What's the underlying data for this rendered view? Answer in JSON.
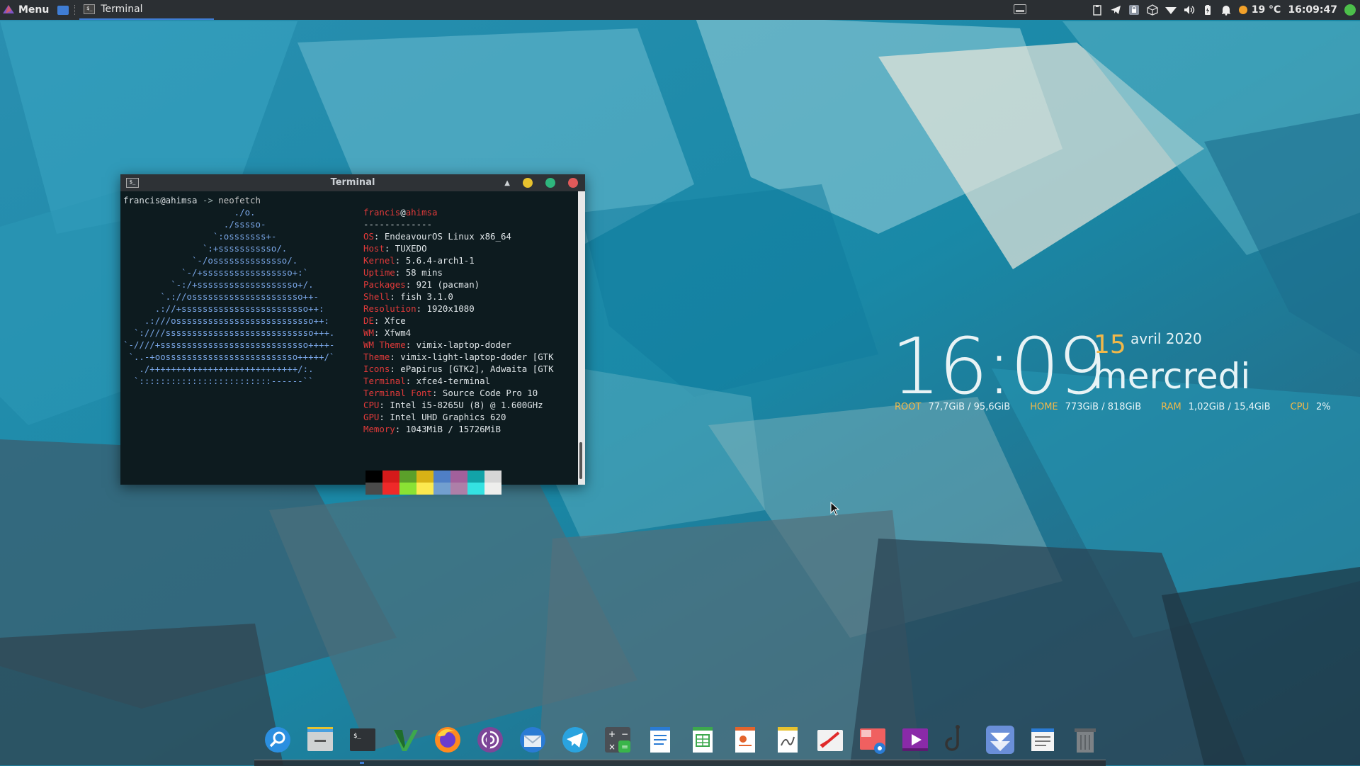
{
  "top_panel": {
    "menu_label": "Menu",
    "task_title": "Terminal",
    "temperature": "19 °C",
    "clock": "16:09:47"
  },
  "conky": {
    "time": "16:09",
    "day_number": "15",
    "month_year": "avril 2020",
    "weekday": "mercredi",
    "stats": [
      {
        "label": "ROOT",
        "value": "77,7GiB / 95,6GiB"
      },
      {
        "label": "HOME",
        "value": "773GiB / 818GiB"
      },
      {
        "label": "RAM",
        "value": "1,02GiB / 15,4GiB"
      },
      {
        "label": "CPU",
        "value": "2%"
      }
    ]
  },
  "terminal": {
    "title": "Terminal",
    "prompt_user": "francis@ahimsa",
    "prompt_arrow": " -> ",
    "command": "neofetch",
    "ascii_art": [
      "                     ./o.",
      "                   ./sssso-",
      "                 `:osssssss+-",
      "               `:+sssssssssso/.",
      "             `-/ossssssssssssso/.",
      "           `-/+sssssssssssssssso+:`",
      "         `-:/+sssssssssssssssssso+/.",
      "       `.://osssssssssssssssssssso++-",
      "      .://+ssssssssssssssssssssssso++:",
      "    .:///ossssssssssssssssssssssssso++:",
      "  `:////ssssssssssssssssssssssssssso+++.",
      "`-////+ssssssssssssssssssssssssssso++++-",
      " `..-+oosssssssssssssssssssssssso+++++/`",
      "   ./++++++++++++++++++++++++++++/:.",
      "  `:::::::::::::::::::::::::------``"
    ],
    "info_user": "francis",
    "info_at": "@",
    "info_host": "ahimsa",
    "info_sep": "-------------",
    "info": [
      {
        "key": "OS",
        "value": "EndeavourOS Linux x86_64"
      },
      {
        "key": "Host",
        "value": "TUXEDO"
      },
      {
        "key": "Kernel",
        "value": "5.6.4-arch1-1"
      },
      {
        "key": "Uptime",
        "value": "58 mins"
      },
      {
        "key": "Packages",
        "value": "921 (pacman)"
      },
      {
        "key": "Shell",
        "value": "fish 3.1.0"
      },
      {
        "key": "Resolution",
        "value": "1920x1080"
      },
      {
        "key": "DE",
        "value": "Xfce"
      },
      {
        "key": "WM",
        "value": "Xfwm4"
      },
      {
        "key": "WM Theme",
        "value": "vimix-laptop-doder"
      },
      {
        "key": "Theme",
        "value": "vimix-light-laptop-doder [GTK"
      },
      {
        "key": "Icons",
        "value": "ePapirus [GTK2], Adwaita [GTK"
      },
      {
        "key": "Terminal",
        "value": "xfce4-terminal"
      },
      {
        "key": "Terminal Font",
        "value": "Source Code Pro 10"
      },
      {
        "key": "CPU",
        "value": "Intel i5-8265U (8) @ 1.600GHz"
      },
      {
        "key": "GPU",
        "value": "Intel UHD Graphics 620"
      },
      {
        "key": "Memory",
        "value": "1043MiB / 15726MiB"
      }
    ],
    "palette_top": [
      "#000000",
      "#d41a1a",
      "#5ba02a",
      "#d7b216",
      "#4f7fc6",
      "#a2609b",
      "#12a3a8",
      "#d6d6d6"
    ],
    "palette_bottom": [
      "#4a4a4a",
      "#ef2929",
      "#8ae234",
      "#fce94f",
      "#729fcf",
      "#ad7fa8",
      "#34e2e2",
      "#eeeeec"
    ]
  },
  "dock_items": [
    "search-icon",
    "file-manager-icon",
    "terminal-icon",
    "vim-icon",
    "firefox-icon",
    "tor-browser-icon",
    "thunderbird-icon",
    "telegram-icon",
    "calculator-icon",
    "writer-icon",
    "calc-icon",
    "impress-icon",
    "draw-icon",
    "notes-icon",
    "screenshot-icon",
    "media-player-icon",
    "hook-icon",
    "endeavouros-icon",
    "text-editor-icon",
    "trash-icon"
  ],
  "colors": {
    "accent": "#3f7dd4",
    "conky_label": "#f0b84a",
    "close": "#e05a5a",
    "minimize": "#e7c22e",
    "maximize": "#2eb67d"
  }
}
